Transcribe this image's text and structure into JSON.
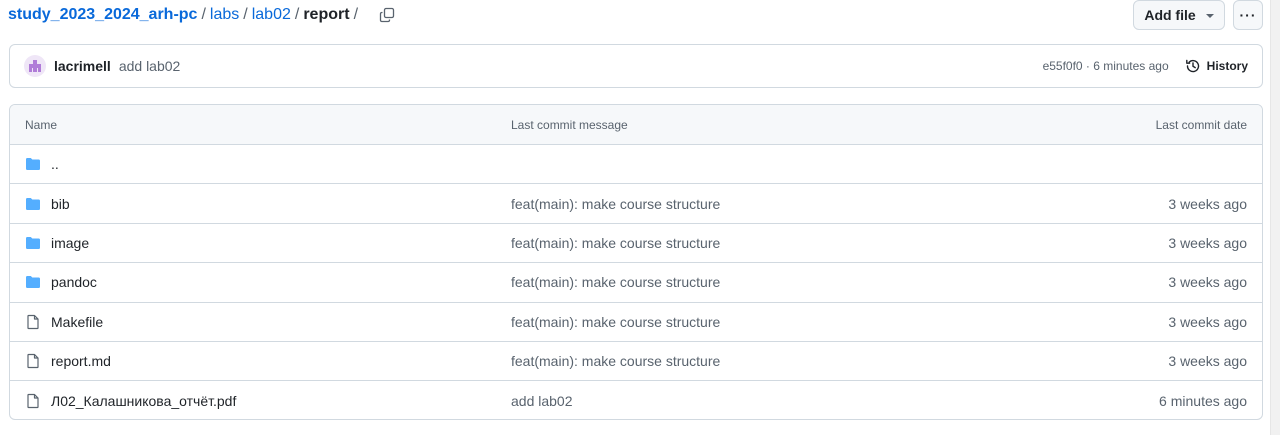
{
  "breadcrumb": {
    "repo": "study_2023_2024_arh-pc",
    "items": [
      "labs",
      "lab02"
    ],
    "current": "report",
    "separator": "/"
  },
  "actions": {
    "add_file_label": "Add file",
    "more_label": "···"
  },
  "commit": {
    "author": "lacrimell",
    "message": "add lab02",
    "meta": "e55f0f0 · 6 minutes ago",
    "history_label": "History"
  },
  "table": {
    "headers": {
      "name": "Name",
      "message": "Last commit message",
      "date": "Last commit date"
    },
    "rows": [
      {
        "name": "..",
        "type": "folder",
        "message": "",
        "date": ""
      },
      {
        "name": "bib",
        "type": "folder",
        "message": "feat(main): make course structure",
        "date": "3 weeks ago"
      },
      {
        "name": "image",
        "type": "folder",
        "message": "feat(main): make course structure",
        "date": "3 weeks ago"
      },
      {
        "name": "pandoc",
        "type": "folder",
        "message": "feat(main): make course structure",
        "date": "3 weeks ago"
      },
      {
        "name": "Makefile",
        "type": "file",
        "message": "feat(main): make course structure",
        "date": "3 weeks ago"
      },
      {
        "name": "report.md",
        "type": "file",
        "message": "feat(main): make course structure",
        "date": "3 weeks ago"
      },
      {
        "name": "Л02_Калашникова_отчёт.pdf",
        "type": "file",
        "message": "add lab02",
        "date": "6 minutes ago"
      }
    ]
  },
  "icons": {
    "folder": "folder-icon",
    "file": "file-icon",
    "copy": "copy-icon",
    "history": "history-icon",
    "dropdown": "chevron-down-icon"
  },
  "colors": {
    "link": "#0969da",
    "folder": "#54aeff",
    "muted": "#59636e",
    "border": "#d1d9e0",
    "header_bg": "#f6f8fa"
  }
}
